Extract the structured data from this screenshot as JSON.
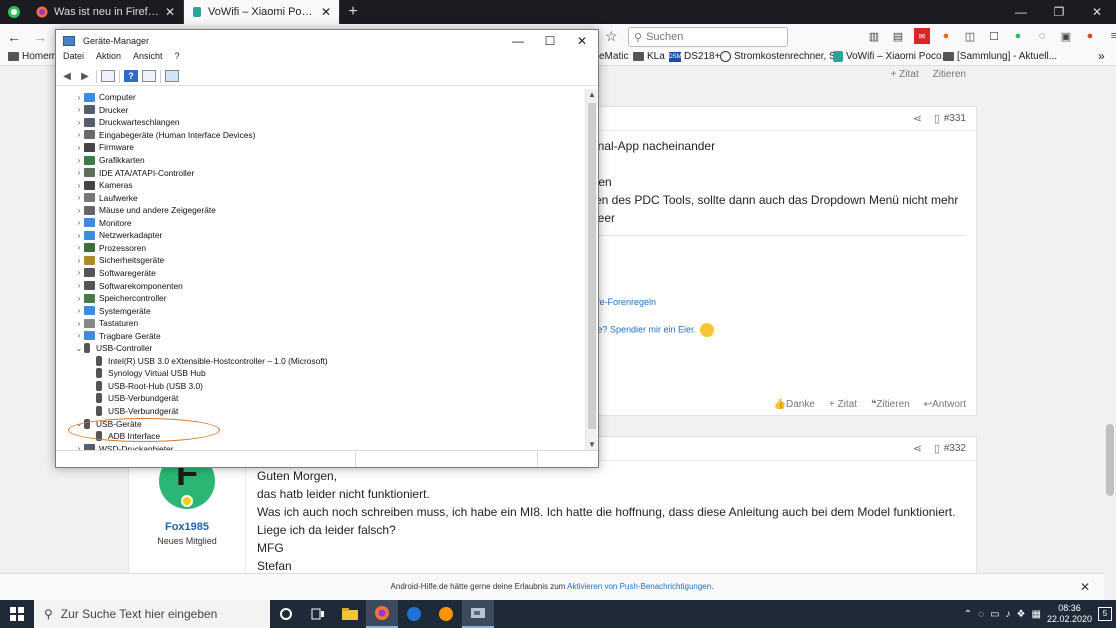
{
  "browser": {
    "tabs": [
      {
        "label": "Was ist neu in Firefox? Mach Fi",
        "active": false
      },
      {
        "label": "VoWifi – Xiaomi Pocophone F1 ",
        "active": true
      }
    ],
    "new_tab": "+",
    "search_placeholder": "Suchen",
    "bookmarks": [
      {
        "label": "Homema",
        "icon": "folder"
      },
      {
        "label": "eMatic",
        "icon": "folder"
      },
      {
        "label": "KLa",
        "icon": "folder"
      },
      {
        "label": "DS218+",
        "icon": "synology-logo"
      },
      {
        "label": "Stromkostenrechner, S...",
        "icon": "globe"
      },
      {
        "label": "VoWifi – Xiaomi Poco...",
        "icon": "site"
      },
      {
        "label": "[Sammlung] - Aktuell...",
        "icon": "folder"
      }
    ],
    "bookmarks_more": "»"
  },
  "device_manager": {
    "title": "Geräte-Manager",
    "menu": [
      "Datei",
      "Aktion",
      "Ansicht",
      "?"
    ],
    "tree": [
      {
        "label": "Computer",
        "level": 0,
        "expand": "›",
        "color": "#3c8de0"
      },
      {
        "label": "Drucker",
        "level": 0,
        "expand": "›",
        "color": "#555f6e"
      },
      {
        "label": "Druckwarteschlangen",
        "level": 0,
        "expand": "›",
        "color": "#555f6e"
      },
      {
        "label": "Eingabegeräte (Human Interface Devices)",
        "level": 0,
        "expand": "›",
        "color": "#6a6a6a"
      },
      {
        "label": "Firmware",
        "level": 0,
        "expand": "›",
        "color": "#444444"
      },
      {
        "label": "Grafikkarten",
        "level": 0,
        "expand": "›",
        "color": "#3a7d44"
      },
      {
        "label": "IDE ATA/ATAPI-Controller",
        "level": 0,
        "expand": "›",
        "color": "#5a6e5a"
      },
      {
        "label": "Kameras",
        "level": 0,
        "expand": "›",
        "color": "#444444"
      },
      {
        "label": "Laufwerke",
        "level": 0,
        "expand": "›",
        "color": "#777777"
      },
      {
        "label": "Mäuse und andere Zeigegeräte",
        "level": 0,
        "expand": "›",
        "color": "#666666"
      },
      {
        "label": "Monitore",
        "level": 0,
        "expand": "›",
        "color": "#3c8de0"
      },
      {
        "label": "Netzwerkadapter",
        "level": 0,
        "expand": "›",
        "color": "#3c8de0"
      },
      {
        "label": "Prozessoren",
        "level": 0,
        "expand": "›",
        "color": "#3a6e3a"
      },
      {
        "label": "Sicherheitsgeräte",
        "level": 0,
        "expand": "›",
        "color": "#b08a2a"
      },
      {
        "label": "Softwaregeräte",
        "level": 0,
        "expand": "›",
        "color": "#555555"
      },
      {
        "label": "Softwarekomponenten",
        "level": 0,
        "expand": "›",
        "color": "#555555"
      },
      {
        "label": "Speichercontroller",
        "level": 0,
        "expand": "›",
        "color": "#4a7a4a"
      },
      {
        "label": "Systemgeräte",
        "level": 0,
        "expand": "›",
        "color": "#3c8de0"
      },
      {
        "label": "Tastaturen",
        "level": 0,
        "expand": "›",
        "color": "#888888"
      },
      {
        "label": "Tragbare Geräte",
        "level": 0,
        "expand": "›",
        "color": "#3c8de0"
      },
      {
        "label": "USB-Controller",
        "level": 0,
        "expand": "⌄",
        "color": "usb"
      },
      {
        "label": "Intel(R) USB 3.0 eXtensible-Hostcontroller – 1.0 (Microsoft)",
        "level": 1,
        "expand": "",
        "color": "usb"
      },
      {
        "label": "Synology Virtual USB Hub",
        "level": 1,
        "expand": "",
        "color": "usb"
      },
      {
        "label": "USB-Root-Hub (USB 3.0)",
        "level": 1,
        "expand": "",
        "color": "usb"
      },
      {
        "label": "USB-Verbundgerät",
        "level": 1,
        "expand": "",
        "color": "usb"
      },
      {
        "label": "USB-Verbundgerät",
        "level": 1,
        "expand": "",
        "color": "usb"
      },
      {
        "label": "USB-Geräte",
        "level": 0,
        "expand": "⌄",
        "color": "usb"
      },
      {
        "label": "ADB Interface",
        "level": 1,
        "expand": "",
        "color": "usb"
      },
      {
        "label": "WSD-Druckanbieter",
        "level": 0,
        "expand": "›",
        "color": "#555f6e"
      }
    ]
  },
  "forum": {
    "top_actions": [
      "+ Zitat",
      "Zitieren"
    ],
    "post1": {
      "number": "#331",
      "lines": [
        "inal-App nacheinander",
        "ten",
        "en des PDC Tools, sollte dann auch das Dropdown Menü nicht mehr leer"
      ],
      "link1": "lfe-Forenregeln",
      "link2": "fe? Spendier mir ein Eier.",
      "actions": [
        "Danke",
        "+ Zitat",
        "Zitieren",
        "Antwort"
      ]
    },
    "post2": {
      "number": "#332",
      "author_initial": "F",
      "author": "Fox1985",
      "role": "Neues Mitglied",
      "lines": [
        "Guten Morgen,",
        "das hatb leider nicht funktioniert.",
        "Was ich auch noch schreiben muss, ich habe ein MI8. Ich hatte die hoffnung, dass diese Anleitung auch bei dem Model funktioniert.",
        "Liege ich da leider falsch?",
        "MFG",
        "Stefan"
      ]
    },
    "notification": {
      "text": "Android-Hilfe.de hätte gerne deine Erlaubnis zum ",
      "link": "Aktivieren von Push-Benachrichtigungen",
      "end": ".",
      "close": "✕"
    }
  },
  "taskbar": {
    "search_placeholder": "Zur Suche Text hier eingeben",
    "time": "08:36",
    "date": "22.02.2020",
    "notifications": "5"
  }
}
